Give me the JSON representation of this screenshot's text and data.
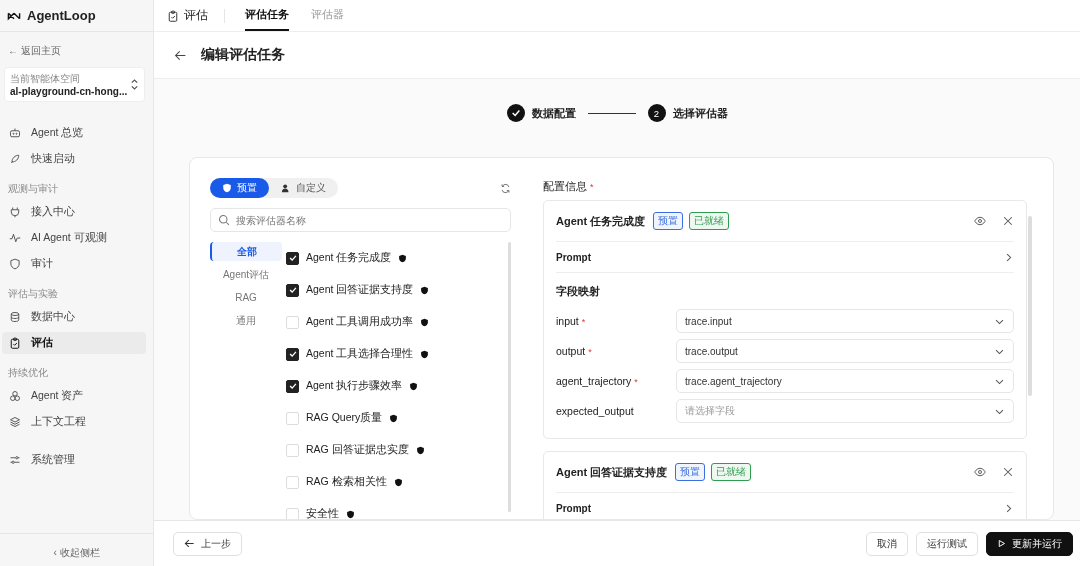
{
  "sidebar": {
    "logo": "AgentLoop",
    "back": "← 返回主页",
    "workspace": {
      "label": "当前智能体空间",
      "value": "al-playground-cn-hong..."
    },
    "groups": [
      {
        "items": [
          {
            "label": "Agent 总览",
            "selected": false
          },
          {
            "label": "快速启动",
            "selected": false
          }
        ]
      },
      {
        "title": "观测与审计",
        "items": [
          {
            "label": "接入中心",
            "selected": false
          },
          {
            "label": "AI Agent 可观测",
            "selected": false
          },
          {
            "label": "审计",
            "selected": false
          }
        ]
      },
      {
        "title": "评估与实验",
        "items": [
          {
            "label": "数据中心",
            "selected": false
          },
          {
            "label": "评估",
            "selected": true
          }
        ]
      },
      {
        "title": "持续优化",
        "items": [
          {
            "label": "Agent 资产",
            "selected": false
          },
          {
            "label": "上下文工程",
            "selected": false
          }
        ]
      },
      {
        "items": [
          {
            "label": "系统管理",
            "selected": false
          }
        ]
      }
    ],
    "collapse": "‹  收起侧栏"
  },
  "header": {
    "section": "评估",
    "tabs": [
      {
        "label": "评估任务",
        "selected": true
      },
      {
        "label": "评估器",
        "selected": false
      }
    ]
  },
  "page_title": "编辑评估任务",
  "steps": [
    {
      "label": "数据配置",
      "done": true
    },
    {
      "number": "2",
      "label": "选择评估器",
      "done": false
    }
  ],
  "evaluator_panel": {
    "toggle": [
      {
        "label": "预置",
        "selected": true
      },
      {
        "label": "自定义",
        "selected": false
      }
    ],
    "search": {
      "placeholder": "搜索评估器名称"
    },
    "categories": [
      {
        "label": "全部",
        "selected": true
      },
      {
        "label": "Agent评估",
        "selected": false
      },
      {
        "label": "RAG",
        "selected": false
      },
      {
        "label": "通用",
        "selected": false
      }
    ],
    "evaluators": [
      {
        "label": "Agent 任务完成度",
        "checked": true
      },
      {
        "label": "Agent 回答证据支持度",
        "checked": true
      },
      {
        "label": "Agent 工具调用成功率",
        "checked": false
      },
      {
        "label": "Agent 工具选择合理性",
        "checked": true
      },
      {
        "label": "Agent 执行步骤效率",
        "checked": true
      },
      {
        "label": "RAG Query质量",
        "checked": false
      },
      {
        "label": "RAG 回答证据忠实度",
        "checked": false
      },
      {
        "label": "RAG 检索相关性",
        "checked": false
      },
      {
        "label": "安全性",
        "checked": false
      }
    ]
  },
  "config": {
    "title": "配置信息",
    "required_mark": "*",
    "cards": [
      {
        "name": "Agent 任务完成度",
        "tags": [
          {
            "label": "预置",
            "color": "#3b6fe0"
          },
          {
            "label": "已就绪",
            "color": "#2e9d4f"
          }
        ],
        "prompt": "Prompt",
        "mapping_title": "字段映射",
        "fields": [
          {
            "name": "input",
            "required": true,
            "value": "trace.input"
          },
          {
            "name": "output",
            "required": true,
            "value": "trace.output"
          },
          {
            "name": "agent_trajectory",
            "required": true,
            "value": "trace.agent_trajectory"
          },
          {
            "name": "expected_output",
            "required": false,
            "placeholder": "请选择字段"
          }
        ]
      },
      {
        "name": "Agent 回答证据支持度",
        "tags": [
          {
            "label": "预置",
            "color": "#3b6fe0"
          },
          {
            "label": "已就绪",
            "color": "#2e9d4f"
          }
        ],
        "prompt": "Prompt"
      }
    ]
  },
  "footer": {
    "prev": "上一步",
    "buttons": [
      {
        "label": "取消",
        "kind": "plain"
      },
      {
        "label": "运行测试",
        "kind": "plain"
      },
      {
        "label": "更新并运行",
        "kind": "primary"
      }
    ]
  }
}
